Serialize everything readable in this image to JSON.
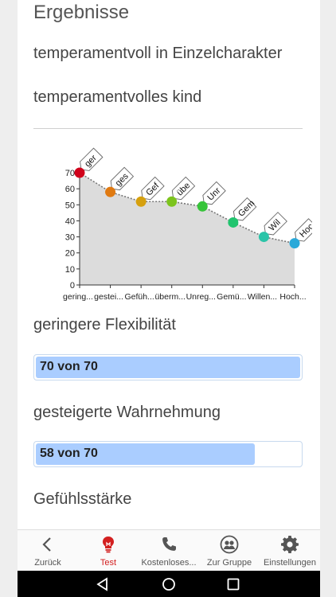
{
  "header": {
    "title": "Ergebnisse",
    "subtitle1": "temperamentvoll in Einzelcharakter",
    "subtitle2": "temperamentvolles kind"
  },
  "chart_data": {
    "type": "area",
    "categories": [
      "gering...",
      "gestei...",
      "Gefüh...",
      "überm...",
      "Unreg...",
      "Gemü...",
      "Willen...",
      "Hoch..."
    ],
    "point_labels": [
      "ger",
      "ges",
      "Gef",
      "übe",
      "Unr",
      "Gem",
      "Wil",
      "Hoc"
    ],
    "values": [
      70,
      58,
      52,
      52,
      49,
      39,
      30,
      26
    ],
    "point_colors": [
      "#d0021b",
      "#e07a12",
      "#d6a00e",
      "#7cc41d",
      "#37c43a",
      "#21c46e",
      "#2bc4a8",
      "#2aa9d9"
    ],
    "yticks": [
      0,
      10,
      20,
      30,
      40,
      50,
      60,
      70
    ],
    "ylim": [
      0,
      70
    ],
    "grid": false
  },
  "sections": [
    {
      "title": "geringere Flexibilität",
      "progress_text": "70 von 70",
      "value": 70,
      "max": 70
    },
    {
      "title": "gesteigerte Wahrnehmung",
      "progress_text": "58 von 70",
      "value": 58,
      "max": 70
    },
    {
      "title": "Gefühlsstärke"
    }
  ],
  "tabs": [
    {
      "label": "Zurück",
      "icon": "chevron-left-icon",
      "active": false
    },
    {
      "label": "Test",
      "icon": "lightbulb-icon",
      "active": true
    },
    {
      "label": "Kostenloses...",
      "icon": "phone-icon",
      "active": false
    },
    {
      "label": "Zur Gruppe",
      "icon": "group-icon",
      "active": false
    },
    {
      "label": "Einstellungen",
      "icon": "gear-icon",
      "active": false
    }
  ],
  "colors": {
    "accent": "#d32020",
    "progress_fill": "#aacdff",
    "area_fill": "#dcdcdc"
  }
}
